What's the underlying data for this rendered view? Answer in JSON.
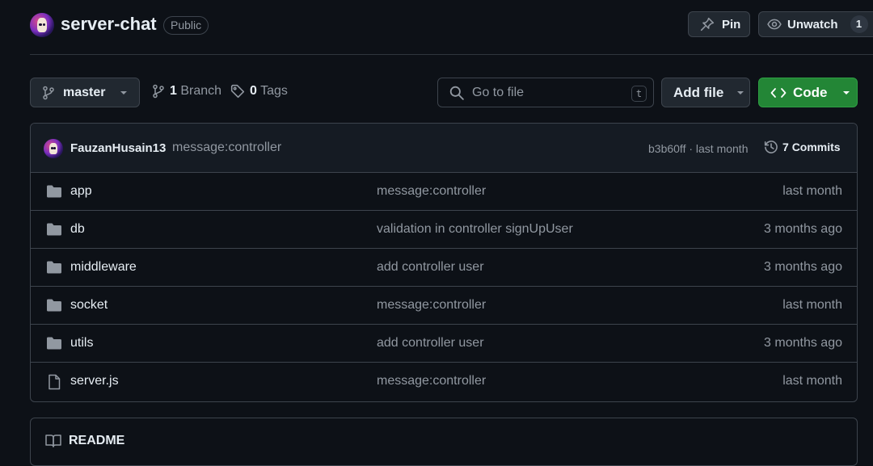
{
  "repo": {
    "name": "server-chat",
    "visibility": "Public",
    "pin_label": "Pin",
    "unwatch_label": "Unwatch",
    "watch_count": "1"
  },
  "toolbar": {
    "branch": "master",
    "branch_count": "1",
    "branch_word": "Branch",
    "tag_count": "0",
    "tag_word": "Tags",
    "search_placeholder": "Go to file",
    "search_shortcut": "t",
    "add_file_label": "Add file",
    "code_label": "Code"
  },
  "latest_commit": {
    "author": "FauzanHusain13",
    "message": "message:controller",
    "meta": "b3b60ff · last month",
    "commits_count": "7",
    "commits_word": "Commits"
  },
  "files": [
    {
      "name": "app",
      "type": "folder",
      "message": "message:controller",
      "date": "last month"
    },
    {
      "name": "db",
      "type": "folder",
      "message": "validation in controller signUpUser",
      "date": "3 months ago"
    },
    {
      "name": "middleware",
      "type": "folder",
      "message": "add controller user",
      "date": "3 months ago"
    },
    {
      "name": "socket",
      "type": "folder",
      "message": "message:controller",
      "date": "last month"
    },
    {
      "name": "utils",
      "type": "folder",
      "message": "add controller user",
      "date": "3 months ago"
    },
    {
      "name": "server.js",
      "type": "file",
      "message": "message:controller",
      "date": "last month"
    }
  ],
  "readme": {
    "title": "README"
  },
  "colors": {
    "background": "#0d1117",
    "border": "#3d444d",
    "code_button": "#238636",
    "muted_text": "#9198a1",
    "text": "#e6edf3"
  }
}
